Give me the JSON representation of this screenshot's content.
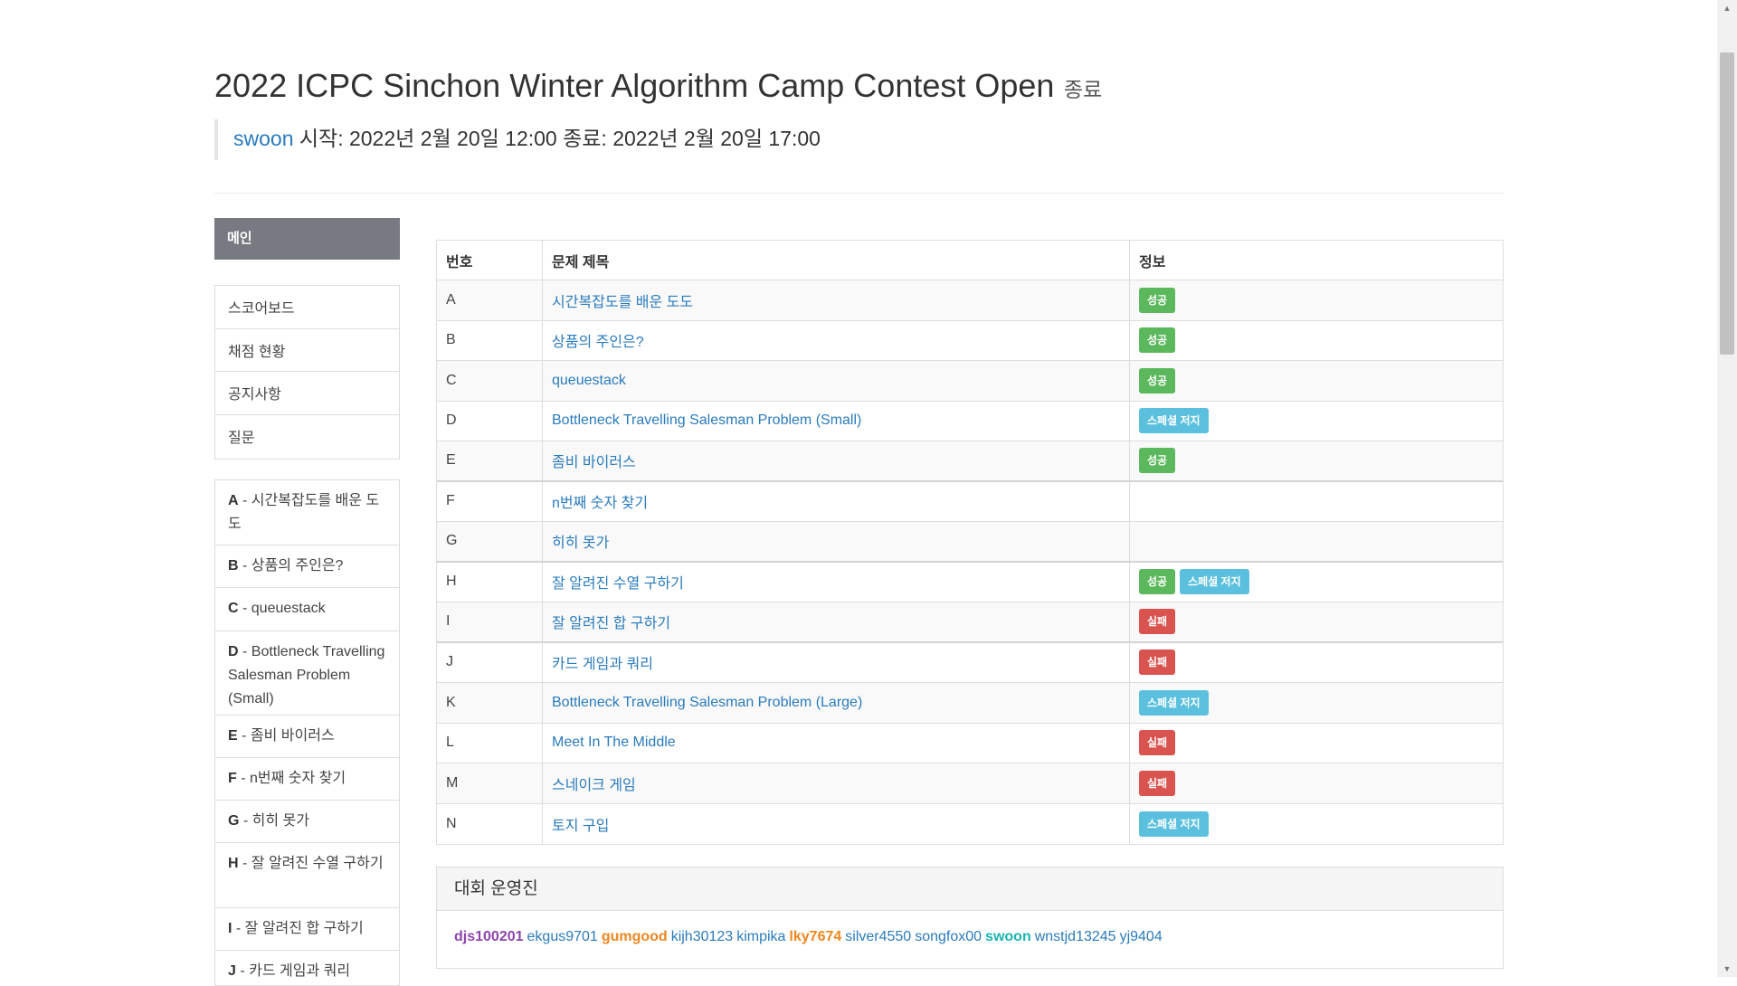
{
  "header": {
    "title": "2022 ICPC Sinchon Winter Algorithm Camp Contest Open",
    "status": "종료",
    "author": "swoon",
    "schedule": " 시작: 2022년 2월 20일 12:00 종료: 2022년 2월 20일 17:00"
  },
  "sidebar": {
    "main_label": "메인",
    "nav": [
      "스코어보드",
      "채점 현황",
      "공지사항",
      "질문"
    ],
    "problems": [
      {
        "id": "A",
        "title": "시간복잡도를 배운 도도"
      },
      {
        "id": "B",
        "title": "상품의 주인은?"
      },
      {
        "id": "C",
        "title": "queuestack"
      },
      {
        "id": "D",
        "title": "Bottleneck Travelling Salesman Problem (Small)"
      },
      {
        "id": "E",
        "title": "좀비 바이러스"
      },
      {
        "id": "F",
        "title": "n번째 숫자 찾기"
      },
      {
        "id": "G",
        "title": "히히 못가"
      },
      {
        "id": "H",
        "title": "잘 알려진 수열 구하기"
      },
      {
        "id": "I",
        "title": "잘 알려진 합 구하기"
      },
      {
        "id": "J",
        "title": "카드 게임과 쿼리"
      }
    ]
  },
  "table": {
    "headers": [
      "번호",
      "문제 제목",
      "정보"
    ],
    "rows": [
      {
        "id": "A",
        "title": "시간복잡도를 배운 도도",
        "badges": [
          {
            "label": "성공",
            "kind": "success"
          }
        ]
      },
      {
        "id": "B",
        "title": "상품의 주인은?",
        "badges": [
          {
            "label": "성공",
            "kind": "success"
          }
        ]
      },
      {
        "id": "C",
        "title": "queuestack",
        "badges": [
          {
            "label": "성공",
            "kind": "success"
          }
        ]
      },
      {
        "id": "D",
        "title": "Bottleneck Travelling Salesman Problem (Small)",
        "badges": [
          {
            "label": "스페셜 저지",
            "kind": "special"
          }
        ]
      },
      {
        "id": "E",
        "title": "좀비 바이러스",
        "badges": [
          {
            "label": "성공",
            "kind": "success"
          }
        ]
      },
      {
        "id": "F",
        "title": "n번째 숫자 찾기",
        "badges": []
      },
      {
        "id": "G",
        "title": "히히 못가",
        "badges": []
      },
      {
        "id": "H",
        "title": "잘 알려진 수열 구하기",
        "badges": [
          {
            "label": "성공",
            "kind": "success"
          },
          {
            "label": "스페셜 저지",
            "kind": "special"
          }
        ]
      },
      {
        "id": "I",
        "title": "잘 알려진 합 구하기",
        "badges": [
          {
            "label": "실패",
            "kind": "fail"
          }
        ]
      },
      {
        "id": "J",
        "title": "카드 게임과 쿼리",
        "badges": [
          {
            "label": "실패",
            "kind": "fail"
          }
        ]
      },
      {
        "id": "K",
        "title": "Bottleneck Travelling Salesman Problem (Large)",
        "badges": [
          {
            "label": "스페셜 저지",
            "kind": "special"
          }
        ]
      },
      {
        "id": "L",
        "title": "Meet In The Middle",
        "badges": [
          {
            "label": "실패",
            "kind": "fail"
          }
        ]
      },
      {
        "id": "M",
        "title": "스네이크 게임",
        "badges": [
          {
            "label": "실패",
            "kind": "fail"
          }
        ]
      },
      {
        "id": "N",
        "title": "토지 구입",
        "badges": [
          {
            "label": "스페셜 저지",
            "kind": "special"
          }
        ]
      }
    ]
  },
  "staff": {
    "title": "대회 운영진",
    "members": [
      {
        "name": "djs100201",
        "style": "purple"
      },
      {
        "name": "ekgus9701",
        "style": "blue"
      },
      {
        "name": "gumgood",
        "style": "orange"
      },
      {
        "name": "kijh30123",
        "style": "blue"
      },
      {
        "name": "kimpika",
        "style": "blue"
      },
      {
        "name": "lky7674",
        "style": "orange"
      },
      {
        "name": "silver4550",
        "style": "blue"
      },
      {
        "name": "songfox00",
        "style": "blue"
      },
      {
        "name": "swoon",
        "style": "teal"
      },
      {
        "name": "wnstjd13245",
        "style": "blue"
      },
      {
        "name": "yj9404",
        "style": "blue"
      }
    ]
  },
  "colors": {
    "link": "#2a7bbd",
    "success": "#5cb85c",
    "special": "#5bc0de",
    "fail": "#d9534f",
    "sidebar_active": "#777a80"
  }
}
